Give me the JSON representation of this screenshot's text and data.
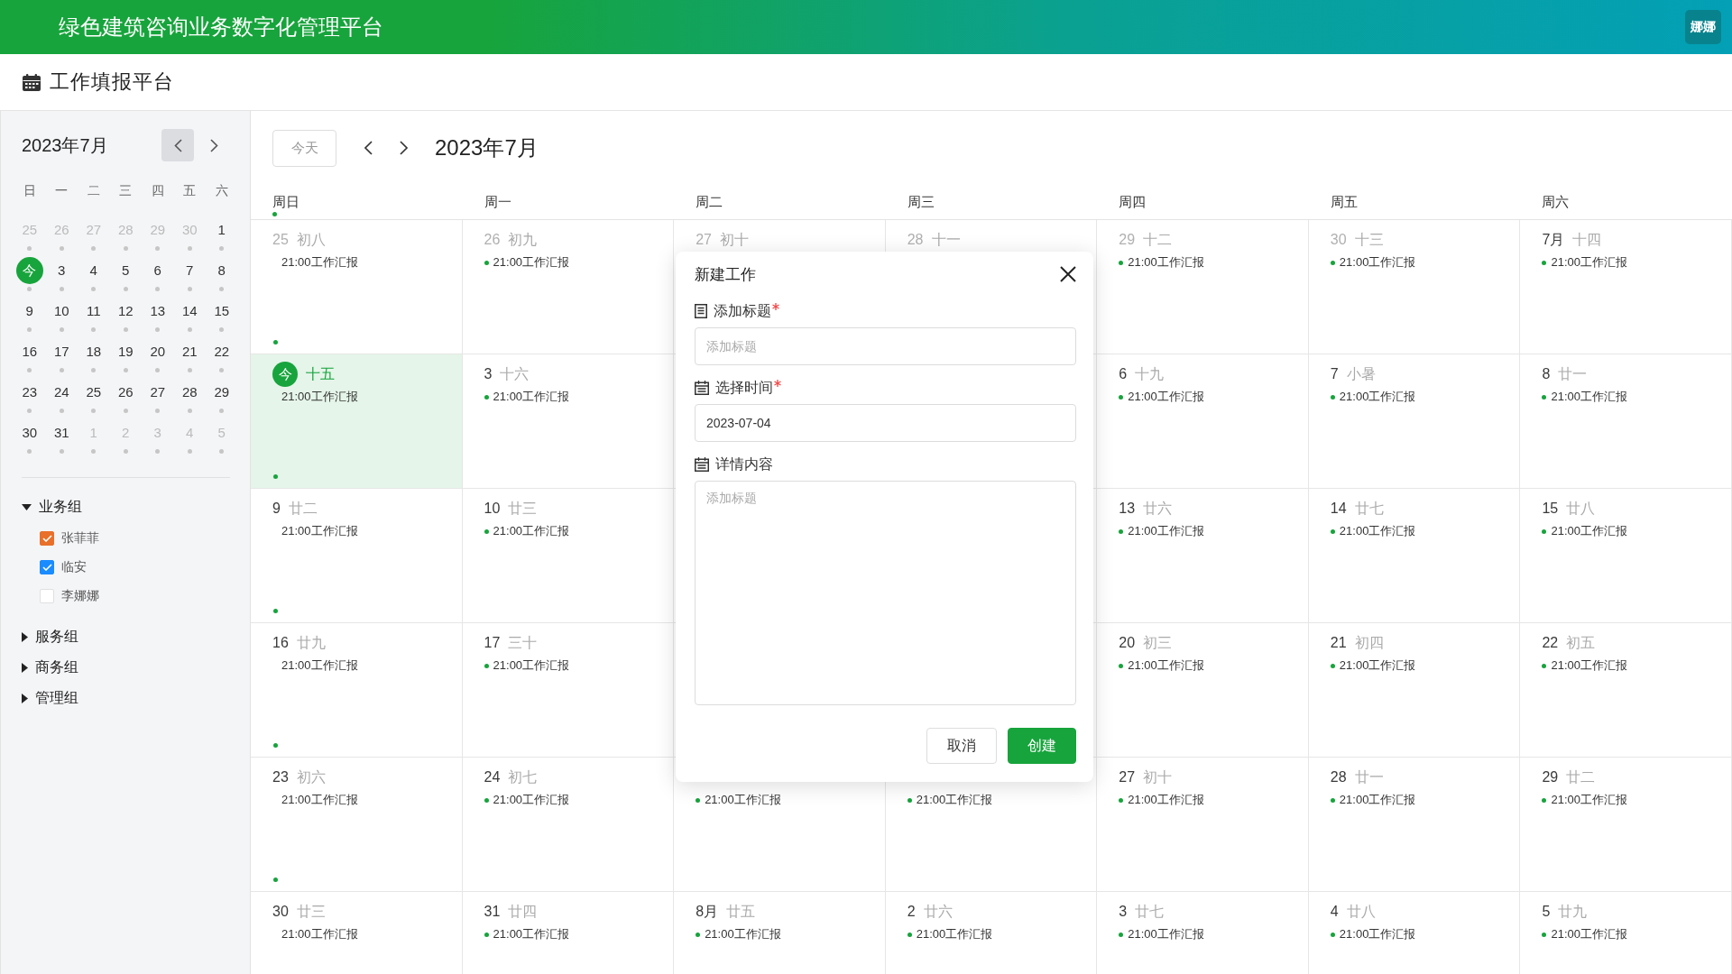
{
  "header": {
    "title": "绿色建筑咨询业务数字化管理平台",
    "avatar": "娜娜"
  },
  "page_title": "工作填报平台",
  "mini_calendar": {
    "title": "2023年7月",
    "nav": [
      {
        "kind": "prev",
        "highlighted": true
      },
      {
        "kind": "next",
        "highlighted": false
      }
    ],
    "weekdays": [
      "日",
      "一",
      "二",
      "三",
      "四",
      "五",
      "六"
    ],
    "weeks": [
      [
        {
          "day": "25",
          "muted": true,
          "today": false
        },
        {
          "day": "26",
          "muted": true,
          "today": false
        },
        {
          "day": "27",
          "muted": true,
          "today": false
        },
        {
          "day": "28",
          "muted": true,
          "today": false
        },
        {
          "day": "29",
          "muted": true,
          "today": false
        },
        {
          "day": "30",
          "muted": true,
          "today": false
        },
        {
          "day": "1",
          "muted": false,
          "today": false
        }
      ],
      [
        {
          "day": "今",
          "today": true
        },
        {
          "day": "3",
          "muted": false,
          "today": false
        },
        {
          "day": "4",
          "muted": false,
          "today": false
        },
        {
          "day": "5",
          "muted": false,
          "today": false
        },
        {
          "day": "6",
          "muted": false,
          "today": false
        },
        {
          "day": "7",
          "muted": false,
          "today": false
        },
        {
          "day": "8",
          "muted": false,
          "today": false
        }
      ],
      [
        {
          "day": "9",
          "muted": false,
          "today": false
        },
        {
          "day": "10",
          "muted": false,
          "today": false
        },
        {
          "day": "11",
          "muted": false,
          "today": false
        },
        {
          "day": "12",
          "muted": false,
          "today": false
        },
        {
          "day": "13",
          "muted": false,
          "today": false
        },
        {
          "day": "14",
          "muted": false,
          "today": false
        },
        {
          "day": "15",
          "muted": false,
          "today": false
        }
      ],
      [
        {
          "day": "16",
          "muted": false,
          "today": false
        },
        {
          "day": "17",
          "muted": false,
          "today": false
        },
        {
          "day": "18",
          "muted": false,
          "today": false
        },
        {
          "day": "19",
          "muted": false,
          "today": false
        },
        {
          "day": "20",
          "muted": false,
          "today": false
        },
        {
          "day": "21",
          "muted": false,
          "today": false
        },
        {
          "day": "22",
          "muted": false,
          "today": false
        }
      ],
      [
        {
          "day": "23",
          "muted": false,
          "today": false
        },
        {
          "day": "24",
          "muted": false,
          "today": false
        },
        {
          "day": "25",
          "muted": false,
          "today": false
        },
        {
          "day": "26",
          "muted": false,
          "today": false
        },
        {
          "day": "27",
          "muted": false,
          "today": false
        },
        {
          "day": "28",
          "muted": false,
          "today": false
        },
        {
          "day": "29",
          "muted": false,
          "today": false
        }
      ],
      [
        {
          "day": "30",
          "muted": false,
          "today": false
        },
        {
          "day": "31",
          "muted": false,
          "today": false
        },
        {
          "day": "1",
          "muted": true,
          "today": false
        },
        {
          "day": "2",
          "muted": true,
          "today": false
        },
        {
          "day": "3",
          "muted": true,
          "today": false
        },
        {
          "day": "4",
          "muted": true,
          "today": false
        },
        {
          "day": "5",
          "muted": true,
          "today": false
        }
      ]
    ]
  },
  "groups": [
    {
      "label": "业务组",
      "expanded": true,
      "children": [
        {
          "label": "张菲菲",
          "checked": true,
          "color": "#e8702a"
        },
        {
          "label": "临安",
          "checked": true,
          "color": "#1a8cff"
        },
        {
          "label": "李娜娜",
          "checked": false
        }
      ]
    },
    {
      "label": "服务组",
      "expanded": false
    },
    {
      "label": "商务组",
      "expanded": false
    },
    {
      "label": "管理组",
      "expanded": false
    }
  ],
  "toolbar": {
    "today_button": "今天",
    "title": "2023年7月"
  },
  "weekdays": [
    {
      "label": "周日",
      "marker": true
    },
    {
      "label": "周一",
      "marker": false
    },
    {
      "label": "周二",
      "marker": false
    },
    {
      "label": "周三",
      "marker": false
    },
    {
      "label": "周四",
      "marker": false
    },
    {
      "label": "周五",
      "marker": false
    },
    {
      "label": "周六",
      "marker": false
    }
  ],
  "weeks": [
    [
      {
        "kind": "day",
        "day": "25",
        "lunar": "初八",
        "muted": true,
        "today": false,
        "marker": true,
        "events": [
          "21:00工作汇报"
        ]
      },
      {
        "kind": "day",
        "day": "26",
        "lunar": "初九",
        "muted": true,
        "today": false,
        "marker": false,
        "events": [
          "21:00工作汇报"
        ]
      },
      {
        "kind": "day",
        "day": "27",
        "lunar": "初十",
        "muted": true,
        "today": false,
        "marker": false
      },
      {
        "kind": "day",
        "day": "28",
        "lunar": "十一",
        "muted": true,
        "today": false,
        "marker": false
      },
      {
        "kind": "day",
        "day": "29",
        "lunar": "十二",
        "muted": true,
        "today": false,
        "marker": false,
        "events": [
          "21:00工作汇报"
        ]
      },
      {
        "kind": "day",
        "day": "30",
        "lunar": "十三",
        "muted": true,
        "today": false,
        "marker": false,
        "events": [
          "21:00工作汇报"
        ]
      },
      {
        "kind": "day",
        "day": "7月",
        "lunar": "十四",
        "muted": false,
        "today": false,
        "marker": false,
        "events": [
          "21:00工作汇报"
        ]
      }
    ],
    [
      {
        "kind": "day",
        "day": "今",
        "lunar": "十五",
        "today": true,
        "marker": true,
        "events": [
          "21:00工作汇报"
        ]
      },
      {
        "kind": "day",
        "day": "3",
        "lunar": "十六",
        "muted": false,
        "today": false,
        "marker": false,
        "events": [
          "21:00工作汇报"
        ]
      },
      {
        "kind": "hidden"
      },
      {
        "kind": "hidden"
      },
      {
        "kind": "day",
        "day": "6",
        "lunar": "十九",
        "muted": false,
        "today": false,
        "marker": false,
        "events": [
          "21:00工作汇报"
        ]
      },
      {
        "kind": "day",
        "day": "7",
        "lunar": "小暑",
        "muted": false,
        "today": false,
        "marker": false,
        "events": [
          "21:00工作汇报"
        ]
      },
      {
        "kind": "day",
        "day": "8",
        "lunar": "廿一",
        "muted": false,
        "today": false,
        "marker": false,
        "events": [
          "21:00工作汇报"
        ]
      }
    ],
    [
      {
        "kind": "day",
        "day": "9",
        "lunar": "廿二",
        "muted": false,
        "today": false,
        "marker": true,
        "events": [
          "21:00工作汇报"
        ]
      },
      {
        "kind": "day",
        "day": "10",
        "lunar": "廿三",
        "muted": false,
        "today": false,
        "marker": false,
        "events": [
          "21:00工作汇报"
        ]
      },
      {
        "kind": "hidden"
      },
      {
        "kind": "hidden"
      },
      {
        "kind": "day",
        "day": "13",
        "lunar": "廿六",
        "muted": false,
        "today": false,
        "marker": false,
        "events": [
          "21:00工作汇报"
        ]
      },
      {
        "kind": "day",
        "day": "14",
        "lunar": "廿七",
        "muted": false,
        "today": false,
        "marker": false,
        "events": [
          "21:00工作汇报"
        ]
      },
      {
        "kind": "day",
        "day": "15",
        "lunar": "廿八",
        "muted": false,
        "today": false,
        "marker": false,
        "events": [
          "21:00工作汇报"
        ]
      }
    ],
    [
      {
        "kind": "day",
        "day": "16",
        "lunar": "廿九",
        "muted": false,
        "today": false,
        "marker": true,
        "events": [
          "21:00工作汇报"
        ]
      },
      {
        "kind": "day",
        "day": "17",
        "lunar": "三十",
        "muted": false,
        "today": false,
        "marker": false,
        "events": [
          "21:00工作汇报"
        ]
      },
      {
        "kind": "hidden"
      },
      {
        "kind": "hidden"
      },
      {
        "kind": "day",
        "day": "20",
        "lunar": "初三",
        "muted": false,
        "today": false,
        "marker": false,
        "events": [
          "21:00工作汇报"
        ]
      },
      {
        "kind": "day",
        "day": "21",
        "lunar": "初四",
        "muted": false,
        "today": false,
        "marker": false,
        "events": [
          "21:00工作汇报"
        ]
      },
      {
        "kind": "day",
        "day": "22",
        "lunar": "初五",
        "muted": false,
        "today": false,
        "marker": false,
        "events": [
          "21:00工作汇报"
        ]
      }
    ],
    [
      {
        "kind": "day",
        "day": "23",
        "lunar": "初六",
        "muted": false,
        "today": false,
        "marker": true,
        "events": [
          "21:00工作汇报"
        ]
      },
      {
        "kind": "day",
        "day": "24",
        "lunar": "初七",
        "muted": false,
        "today": false,
        "marker": false,
        "events": [
          "21:00工作汇报"
        ]
      },
      {
        "kind": "day",
        "events": [
          "21:00工作汇报"
        ]
      },
      {
        "kind": "day",
        "events": [
          "21:00工作汇报"
        ]
      },
      {
        "kind": "day",
        "day": "27",
        "lunar": "初十",
        "muted": false,
        "today": false,
        "marker": false,
        "events": [
          "21:00工作汇报"
        ]
      },
      {
        "kind": "day",
        "day": "28",
        "lunar": "廿一",
        "muted": false,
        "today": false,
        "marker": false,
        "events": [
          "21:00工作汇报"
        ]
      },
      {
        "kind": "day",
        "day": "29",
        "lunar": "廿二",
        "muted": false,
        "today": false,
        "marker": false,
        "events": [
          "21:00工作汇报"
        ]
      }
    ],
    [
      {
        "kind": "day",
        "day": "30",
        "lunar": "廿三",
        "muted": false,
        "today": false,
        "marker": false,
        "events": [
          "21:00工作汇报"
        ]
      },
      {
        "kind": "day",
        "day": "31",
        "lunar": "廿四",
        "muted": false,
        "today": false,
        "marker": false,
        "events": [
          "21:00工作汇报"
        ]
      },
      {
        "kind": "day",
        "day": "8月",
        "lunar": "廿五",
        "muted": false,
        "today": false,
        "marker": false,
        "events": [
          "21:00工作汇报"
        ]
      },
      {
        "kind": "day",
        "day": "2",
        "lunar": "廿六",
        "muted": false,
        "today": false,
        "marker": false,
        "events": [
          "21:00工作汇报"
        ]
      },
      {
        "kind": "day",
        "day": "3",
        "lunar": "廿七",
        "muted": false,
        "today": false,
        "marker": false,
        "events": [
          "21:00工作汇报"
        ]
      },
      {
        "kind": "day",
        "day": "4",
        "lunar": "廿八",
        "muted": false,
        "today": false,
        "marker": false,
        "events": [
          "21:00工作汇报"
        ]
      },
      {
        "kind": "day",
        "day": "5",
        "lunar": "廿九",
        "muted": false,
        "today": false,
        "marker": false,
        "events": [
          "21:00工作汇报"
        ]
      }
    ]
  ],
  "dialog": {
    "title": "新建工作",
    "fields": [
      {
        "kind": "input",
        "label": "添加标题",
        "required": true,
        "placeholder": "添加标题"
      },
      {
        "kind": "date",
        "label": "选择时间",
        "required": true,
        "value": "2023-07-04"
      },
      {
        "kind": "textarea",
        "label": "详情内容",
        "required": false,
        "placeholder": "添加标题"
      }
    ],
    "buttons": [
      {
        "label": "取消",
        "primary": false
      },
      {
        "label": "创建",
        "primary": true
      }
    ]
  }
}
